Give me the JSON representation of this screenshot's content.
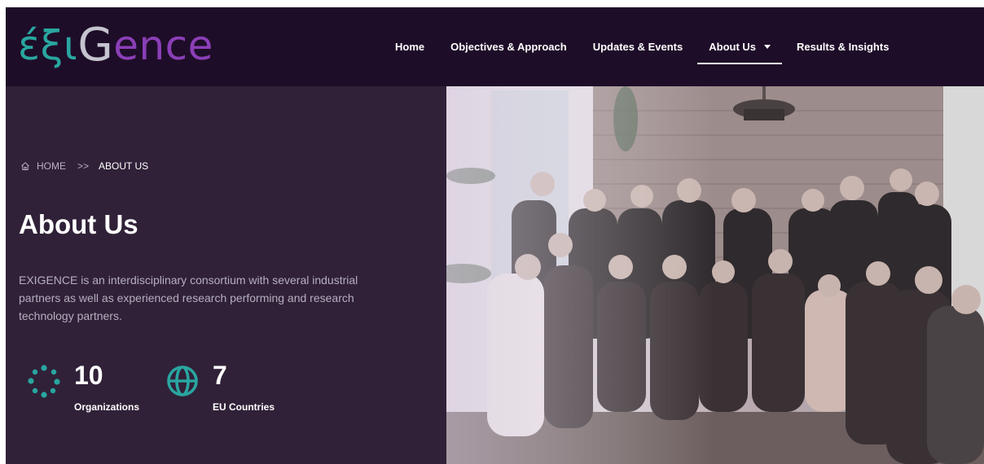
{
  "header": {
    "logo": {
      "part1": "έξι",
      "part2": "G",
      "part3": "ence"
    },
    "nav": [
      {
        "label": "Home"
      },
      {
        "label": "Objectives & Approach"
      },
      {
        "label": "Updates & Events"
      },
      {
        "label": "About Us",
        "active": true,
        "dropdown": true
      },
      {
        "label": "Results & Insights"
      }
    ]
  },
  "breadcrumb": {
    "home": "HOME",
    "separator": ">>",
    "current": "ABOUT US",
    "icon": "home-icon"
  },
  "hero": {
    "title": "About Us",
    "description": "EXIGENCE is an interdisciplinary consortium with several industrial partners as well as experienced research performing and research technology partners."
  },
  "stats": [
    {
      "number": "10",
      "label": "Organizations",
      "icon": "network-dots-icon"
    },
    {
      "number": "7",
      "label": "EU Countries",
      "icon": "globe-icon"
    }
  ],
  "photo": {
    "alt": "Group photo of the consortium team"
  },
  "colors": {
    "header_bg": "#1e0d28",
    "hero_bg": "#302138",
    "accent_teal": "#29a6a0",
    "accent_purple": "#8b3fb7"
  }
}
